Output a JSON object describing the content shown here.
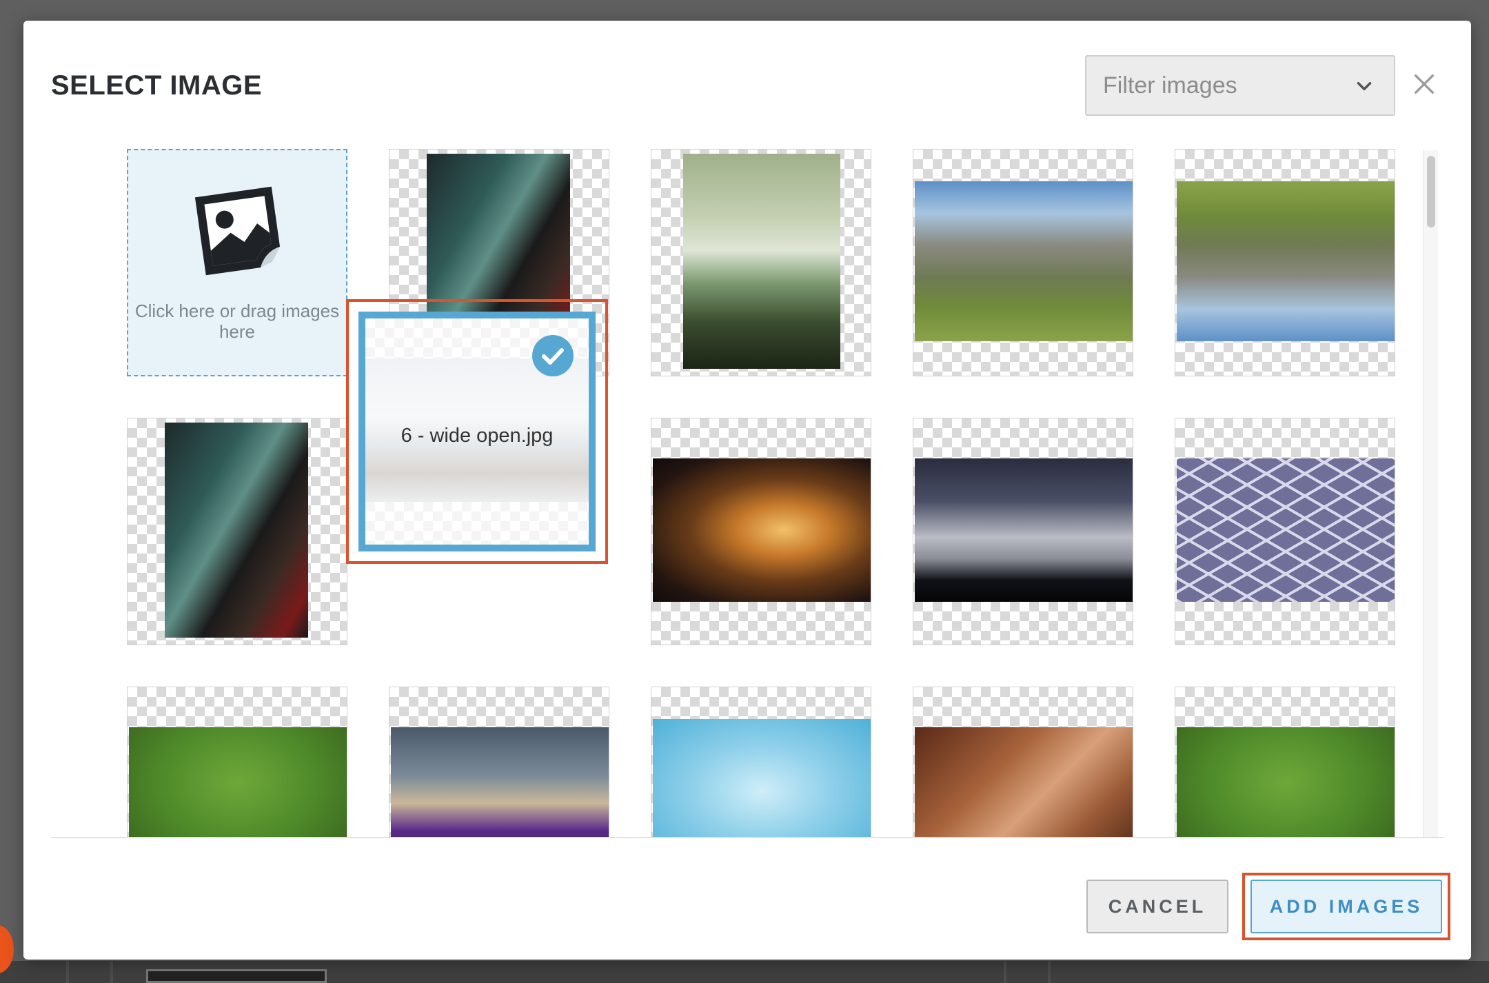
{
  "dialog": {
    "title": "SELECT IMAGE",
    "filter_placeholder": "Filter images",
    "close_icon": "close-icon"
  },
  "upload": {
    "label": "Click here or drag images here",
    "icon": "image-upload-icon"
  },
  "selected": {
    "filename": "6 - wide open.jpg",
    "icon": "checkmark-icon"
  },
  "footer": {
    "cancel_label": "CANCEL",
    "add_label": "ADD IMAGES"
  },
  "colors": {
    "accent": "#57a7d3",
    "highlight": "#d9532c"
  }
}
